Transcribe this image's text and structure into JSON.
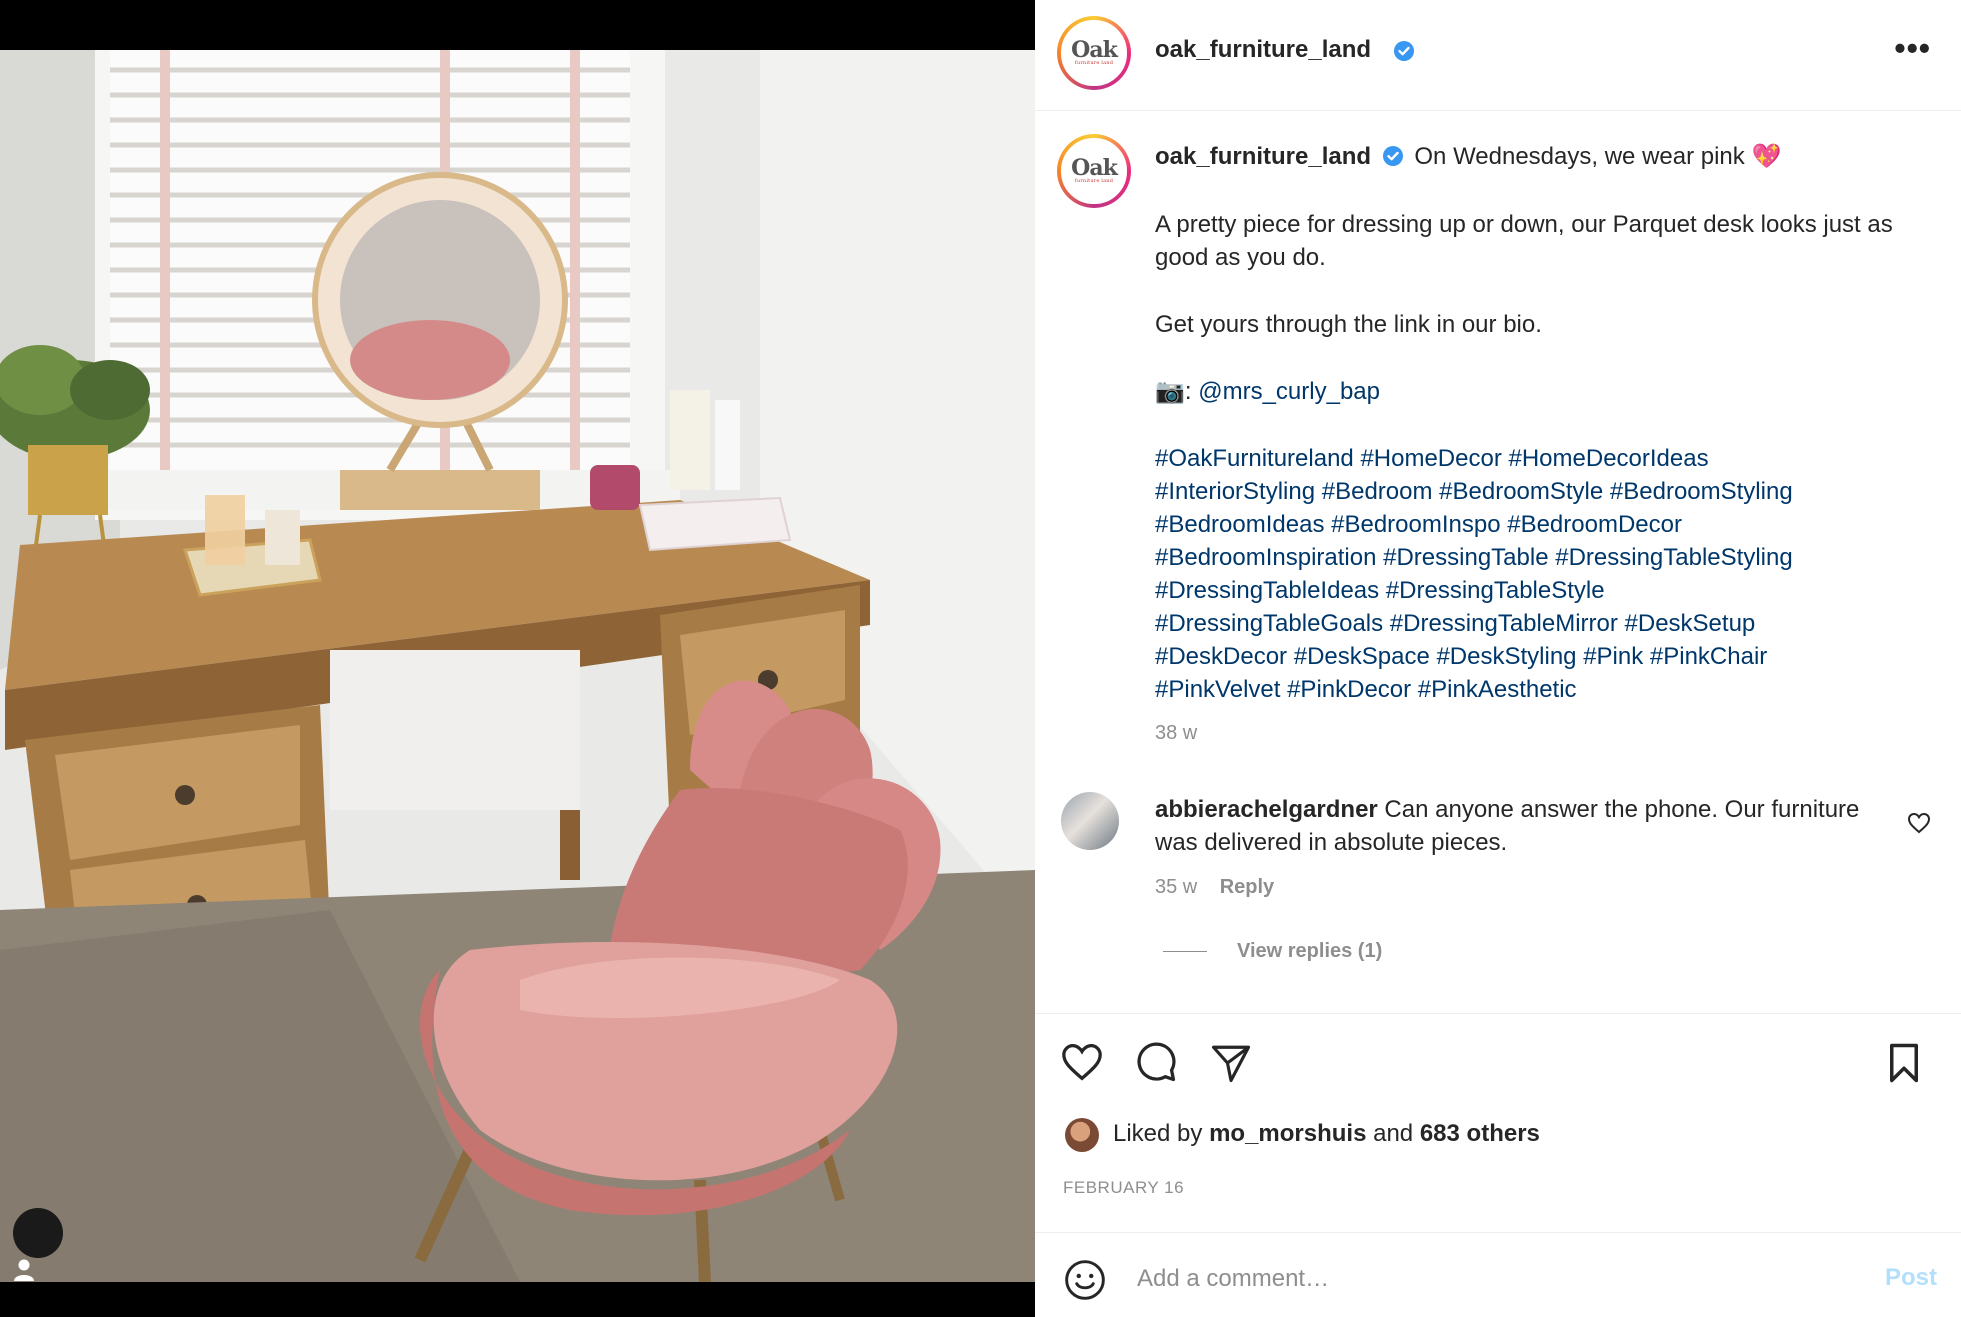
{
  "post": {
    "username": "oak_furniture_land",
    "avatar_text": "Oak",
    "avatar_subtext": "furniture land",
    "caption_first_line": "On Wednesdays, we wear pink 💖",
    "caption_para1": "A pretty piece for dressing up or down, our Parquet desk looks just as good as you do.",
    "caption_para2": "Get yours through the link in our bio.",
    "photo_credit_emoji": "📷:",
    "photo_credit_user": "@mrs_curly_bap",
    "hashtags_lines": [
      "#OakFurnitureland #HomeDecor #HomeDecorIdeas",
      "#InteriorStyling #Bedroom #BedroomStyle #BedroomStyling",
      "#BedroomIdeas #BedroomInspo #BedroomDecor",
      "#BedroomInspiration #DressingTable #DressingTableStyling",
      "#DressingTableIdeas #DressingTableStyle",
      "#DressingTableGoals #DressingTableMirror #DeskSetup",
      "#DeskDecor #DeskSpace #DeskStyling #Pink #PinkChair",
      "#PinkVelvet #PinkDecor #PinkAesthetic"
    ],
    "caption_age": "38 w"
  },
  "comment": {
    "username": "abbierachelgardner",
    "text": "Can anyone answer the phone. Our furniture was delivered in absolute pieces.",
    "age": "35 w",
    "reply_label": "Reply",
    "view_replies_label": "View replies (1)"
  },
  "likes": {
    "prefix": "Liked by",
    "user": "mo_morshuis",
    "middle": "and",
    "others": "683 others"
  },
  "date": "FEBRUARY 16",
  "add_comment": {
    "placeholder": "Add a comment…",
    "post_label": "Post"
  },
  "colors": {
    "link": "#00376b",
    "verified": "#3897f0",
    "muted": "#8e8e8e",
    "post_disabled": "#b2dffc"
  },
  "icons": [
    "more-icon",
    "verified-badge-icon",
    "heart-icon",
    "comment-icon",
    "share-icon",
    "bookmark-icon",
    "emoji-icon",
    "user-tag-icon"
  ]
}
